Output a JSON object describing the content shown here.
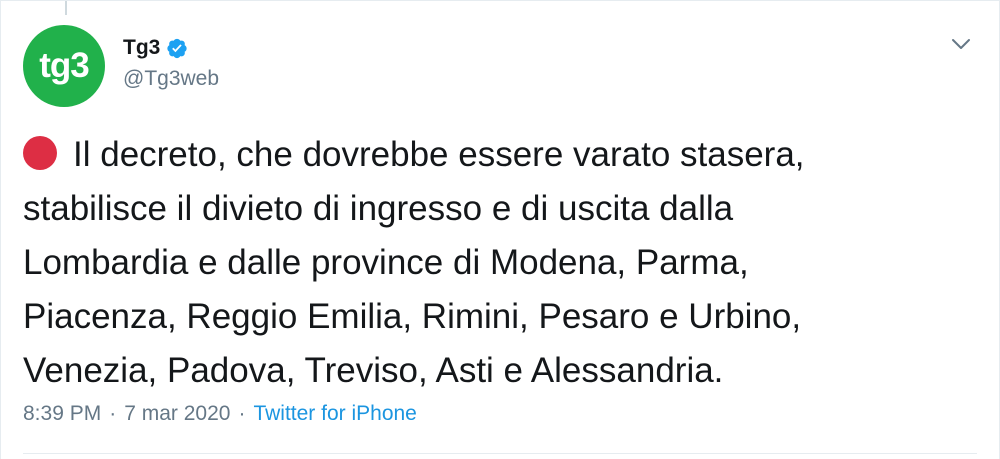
{
  "author": {
    "avatar_text": "tg3",
    "display_name": "Tg3",
    "verified": true,
    "handle": "@Tg3web"
  },
  "tweet": {
    "emoji": "red-circle",
    "lines": [
      "Il decreto, che dovrebbe essere varato stasera,",
      "stabilisce il divieto di ingresso e di uscita dalla",
      "Lombardia e dalle province di Modena, Parma,",
      "Piacenza, Reggio Emilia, Rimini, Pesaro e Urbino,",
      "Venezia, Padova, Treviso, Asti e Alessandria."
    ]
  },
  "meta": {
    "time": "8:39 PM",
    "separator": "·",
    "date": "7 mar 2020",
    "source": "Twitter for iPhone"
  },
  "colors": {
    "avatar_bg": "#21b14b",
    "verified": "#1da1f2",
    "link": "#1b95e0",
    "secondary_text": "#657786",
    "red_circle": "#dd2e44"
  },
  "icons": {
    "verified": "verified-badge-icon",
    "menu": "chevron-down-icon"
  }
}
